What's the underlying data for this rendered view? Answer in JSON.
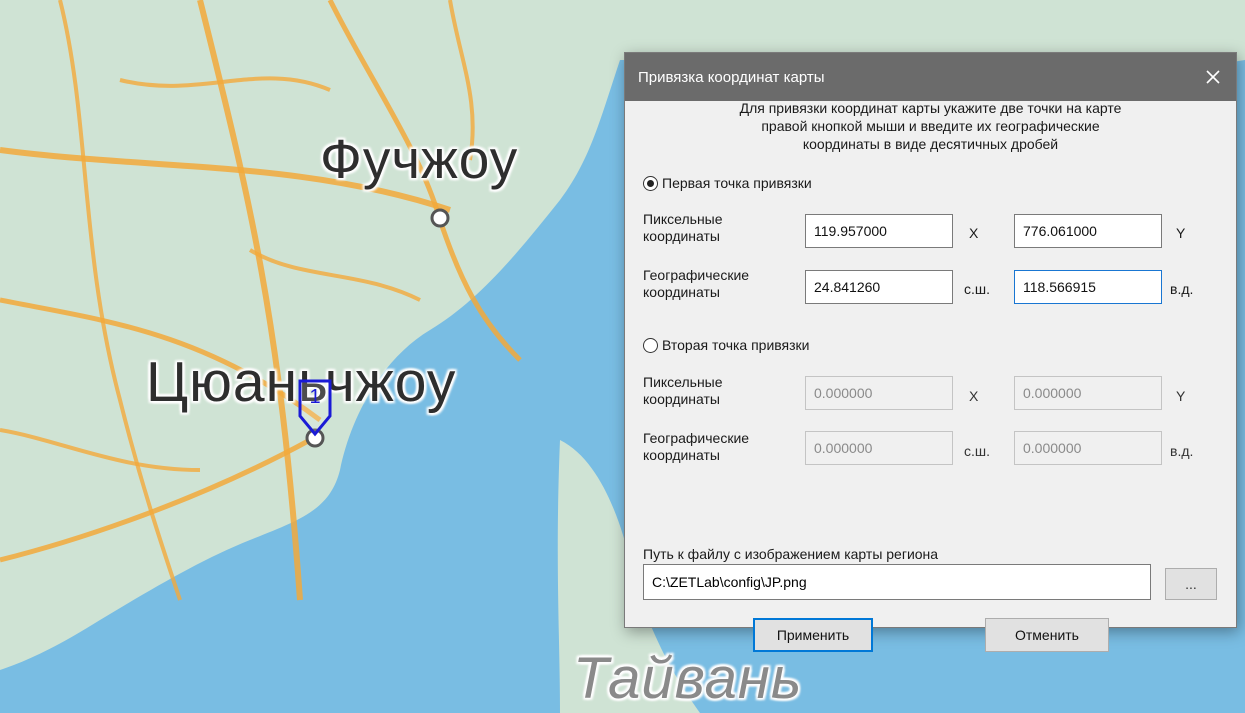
{
  "map": {
    "labels": {
      "fuzhou": "Фучжоу",
      "quanzhou": "Цюаньчжоу",
      "taiwan": "Тайвань"
    },
    "marker_number": "1",
    "colors": {
      "land": "#cfe3d4",
      "sea": "#79bde3",
      "roads": "#f2a93b"
    }
  },
  "dialog": {
    "title": "Привязка координат карты",
    "info": [
      "Для привязки координат карты укажите две точки на карте",
      "правой кнопкой мыши и введите их географические",
      "координаты в виде десятичных дробей"
    ],
    "point1": {
      "label": "Первая точка привязки",
      "selected": true,
      "pixel_label": [
        "Пиксельные",
        "координаты"
      ],
      "geo_label": [
        "Географические",
        "координаты"
      ],
      "pixel_x": "119.957000",
      "pixel_y": "776.061000",
      "lat": "24.841260",
      "lon": "118.566915",
      "unit_x": "X",
      "unit_y": "Y",
      "unit_lat": "с.ш.",
      "unit_lon": "в.д."
    },
    "point2": {
      "label": "Вторая точка привязки",
      "selected": false,
      "pixel_label": [
        "Пиксельные",
        "координаты"
      ],
      "geo_label": [
        "Географические",
        "координаты"
      ],
      "pixel_x": "0.000000",
      "pixel_y": "0.000000",
      "lat": "0.000000",
      "lon": "0.000000",
      "unit_x": "X",
      "unit_y": "Y",
      "unit_lat": "с.ш.",
      "unit_lon": "в.д."
    },
    "path_label": "Путь к файлу с изображением карты региона",
    "path_value": "C:\\ZETLab\\config\\JP.png",
    "browse_label": "...",
    "apply_label": "Применить",
    "cancel_label": "Отменить",
    "close_icon": "close-icon"
  }
}
